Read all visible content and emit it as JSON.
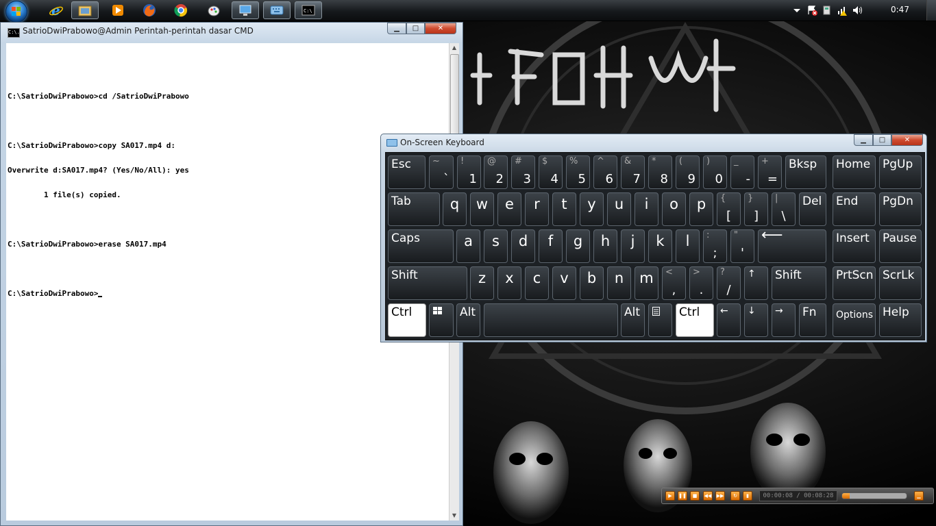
{
  "taskbar": {
    "pinned": [
      {
        "name": "internet-explorer-icon",
        "active": false
      },
      {
        "name": "windows-explorer-icon",
        "active": false
      },
      {
        "name": "media-player-icon",
        "active": false
      },
      {
        "name": "firefox-icon",
        "active": false
      },
      {
        "name": "chrome-icon",
        "active": false
      },
      {
        "name": "paint-icon",
        "active": false
      },
      {
        "name": "remote-desktop-icon",
        "active": true
      },
      {
        "name": "on-screen-keyboard-icon",
        "active": true
      },
      {
        "name": "command-prompt-icon",
        "active": true
      }
    ],
    "clock": "0:47"
  },
  "cmd": {
    "title": "SatrioDwiPrabowo@Admin Perintah-perintah dasar CMD",
    "icon_text": "C:\\.",
    "lines": [
      "",
      "C:\\SatrioDwiPrabowo>cd /SatrioDwiPrabowo",
      "",
      "C:\\SatrioDwiPrabowo>copy SA017.mp4 d:",
      "Overwrite d:SA017.mp4? (Yes/No/All): yes",
      "        1 file(s) copied.",
      "",
      "C:\\SatrioDwiPrabowo>erase SA017.mp4",
      "",
      "C:\\SatrioDwiPrabowo>"
    ]
  },
  "osk": {
    "title": "On-Screen Keyboard",
    "keys": {
      "esc": "Esc",
      "bksp": "Bksp",
      "home": "Home",
      "pgup": "PgUp",
      "tab": "Tab",
      "del": "Del",
      "end": "End",
      "pgdn": "PgDn",
      "caps": "Caps",
      "insert": "Insert",
      "pause": "Pause",
      "shift_l": "Shift",
      "shift_r": "Shift",
      "prtscn": "PrtScn",
      "scrlk": "ScrLk",
      "ctrl_l": "Ctrl",
      "alt_l": "Alt",
      "alt_r": "Alt",
      "ctrl_r": "Ctrl",
      "fn": "Fn",
      "options": "Options",
      "help": "Help",
      "q": "q",
      "w": "w",
      "e": "e",
      "r": "r",
      "t": "t",
      "y": "y",
      "u": "u",
      "i": "i",
      "o": "o",
      "p": "p",
      "a": "a",
      "s": "s",
      "d": "d",
      "f": "f",
      "g": "g",
      "h": "h",
      "j": "j",
      "k": "k",
      "l": "l",
      "z": "z",
      "x": "x",
      "c": "c",
      "v": "v",
      "b": "b",
      "n": "n",
      "m": "m"
    },
    "num_row": [
      {
        "sup": "~",
        "sub": "`"
      },
      {
        "sup": "!",
        "sub": "1"
      },
      {
        "sup": "@",
        "sub": "2"
      },
      {
        "sup": "#",
        "sub": "3"
      },
      {
        "sup": "$",
        "sub": "4"
      },
      {
        "sup": "%",
        "sub": "5"
      },
      {
        "sup": "^",
        "sub": "6"
      },
      {
        "sup": "&",
        "sub": "7"
      },
      {
        "sup": "*",
        "sub": "8"
      },
      {
        "sup": "(",
        "sub": "9"
      },
      {
        "sup": ")",
        "sub": "0"
      },
      {
        "sup": "_",
        "sub": "-"
      },
      {
        "sup": "+",
        "sub": "="
      }
    ],
    "sym": {
      "lbrace": {
        "sup": "{",
        "sub": "["
      },
      "rbrace": {
        "sup": "}",
        "sub": "]"
      },
      "pipe": {
        "sup": "|",
        "sub": "\\"
      },
      "colon": {
        "sup": ":",
        "sub": ";"
      },
      "quote": {
        "sup": "\"",
        "sub": "'"
      },
      "lt": {
        "sup": "<",
        "sub": ","
      },
      "gt": {
        "sup": ">",
        "sub": "."
      },
      "qmark": {
        "sup": "?",
        "sub": "/"
      },
      "up": "↑",
      "left": "←",
      "down": "↓",
      "right": "→",
      "enter": "⟵"
    }
  },
  "player": {
    "time": "00:00:08 / 00:08:28",
    "progress": 0.12
  }
}
